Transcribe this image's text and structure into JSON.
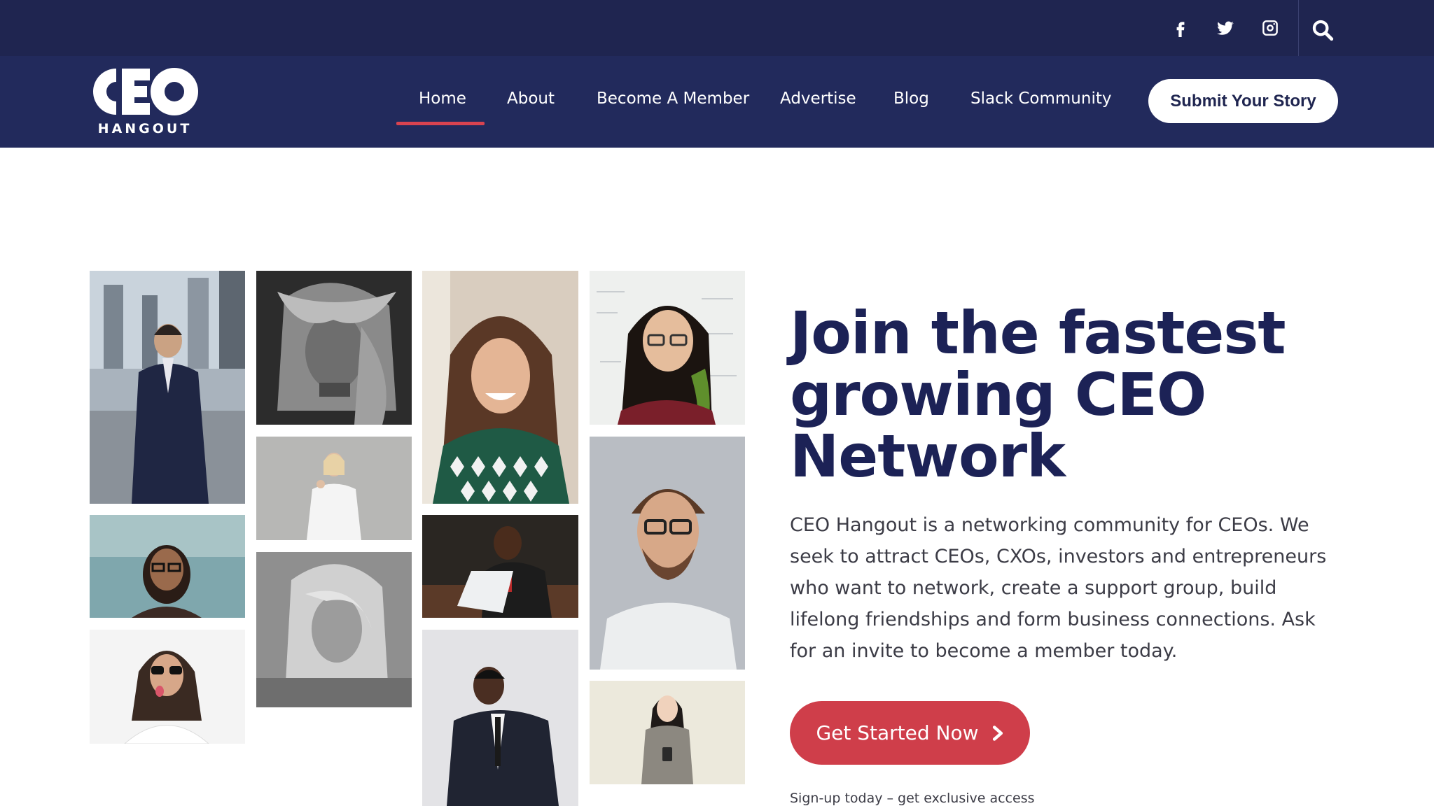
{
  "topbar": {
    "social_icons": [
      "facebook-icon",
      "twitter-icon",
      "instagram-icon"
    ],
    "search_icon": "search-icon"
  },
  "brand": {
    "logo_text": "CEO",
    "logo_subtitle": "HANGOUT"
  },
  "nav": {
    "items": [
      {
        "label": "Home",
        "active": true
      },
      {
        "label": "About"
      },
      {
        "label": "Become A Member"
      },
      {
        "label": "Advertise"
      },
      {
        "label": "Blog"
      },
      {
        "label": "Slack Community"
      }
    ],
    "cta_label": "Submit Your Story"
  },
  "hero": {
    "title": "Join the fastest growing CEO Network",
    "body": "CEO Hangout is a networking community for CEOs. We seek to attract CEOs, CXOs, investors and entrepreneurs who want to network, create a support group, build lifelong friendships and form business connections. Ask for an invite to become a member today.",
    "cta_label": "Get Started Now",
    "cta_icon": "chevron-right-icon",
    "note": "Sign-up today – get exclusive access"
  },
  "colors": {
    "topbar_bg": "#1f2550",
    "navbar_bg": "#222a5c",
    "heading": "#1c2256",
    "accent": "#cf3e4a",
    "body_text": "#3c3c46"
  }
}
